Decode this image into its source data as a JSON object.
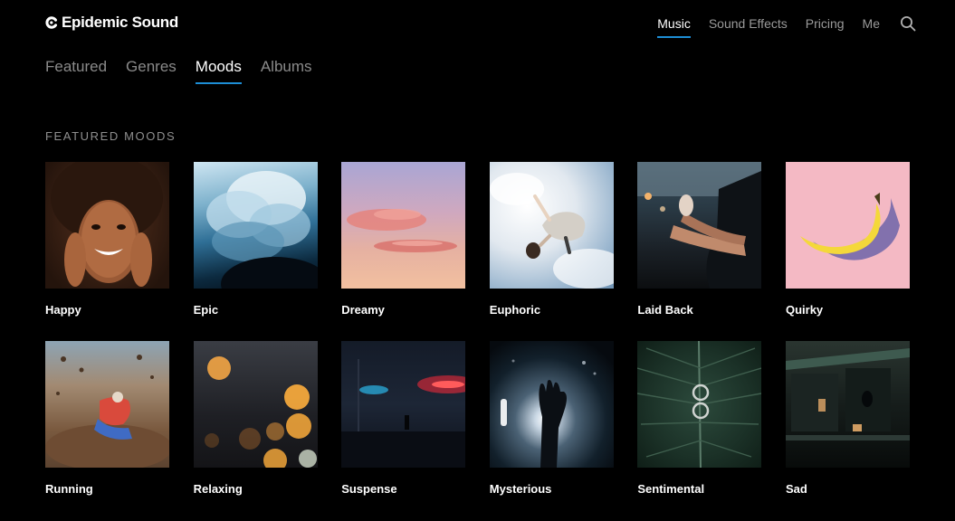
{
  "header": {
    "brand": "Epidemic Sound",
    "nav": [
      {
        "label": "Music",
        "active": true
      },
      {
        "label": "Sound Effects",
        "active": false
      },
      {
        "label": "Pricing",
        "active": false
      },
      {
        "label": "Me",
        "active": false
      }
    ],
    "search_icon": "search-icon"
  },
  "subtabs": [
    {
      "label": "Featured",
      "active": false
    },
    {
      "label": "Genres",
      "active": false
    },
    {
      "label": "Moods",
      "active": true
    },
    {
      "label": "Albums",
      "active": false
    }
  ],
  "section": {
    "title": "FEATURED MOODS"
  },
  "moods": [
    {
      "label": "Happy"
    },
    {
      "label": "Epic"
    },
    {
      "label": "Dreamy"
    },
    {
      "label": "Euphoric"
    },
    {
      "label": "Laid Back"
    },
    {
      "label": "Quirky"
    },
    {
      "label": "Running"
    },
    {
      "label": "Relaxing"
    },
    {
      "label": "Suspense"
    },
    {
      "label": "Mysterious"
    },
    {
      "label": "Sentimental"
    },
    {
      "label": "Sad"
    }
  ],
  "colors": {
    "background": "#000000",
    "accent": "#1d8ed6",
    "inactive_text": "#8a8a8a"
  }
}
